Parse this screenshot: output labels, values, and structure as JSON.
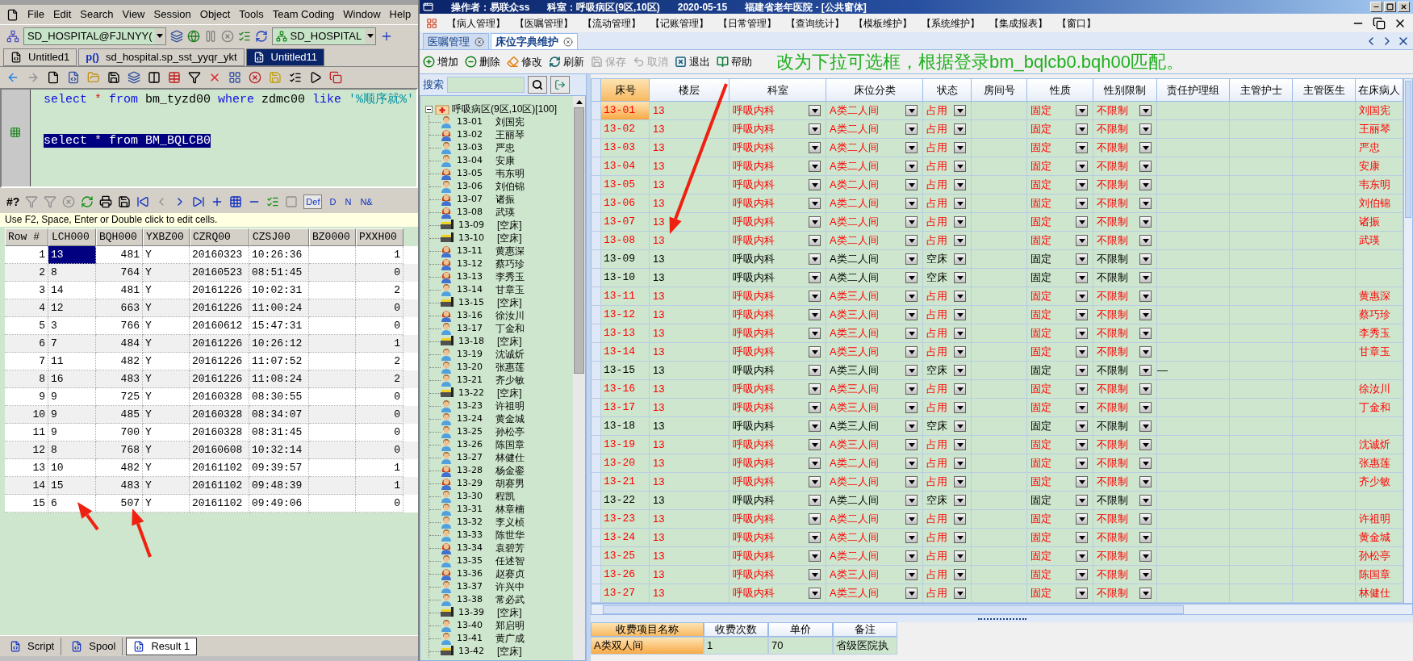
{
  "sql_window": {
    "menu": [
      "File",
      "Edit",
      "Search",
      "View",
      "Session",
      "Object",
      "Tools",
      "Team Coding",
      "Window",
      "Help"
    ],
    "connection": "SD_HOSPITAL@FJLNYY(",
    "schema": "SD_HOSPITAL",
    "tabs": [
      {
        "label": "Untitled1",
        "kind": "sql",
        "selected": false
      },
      {
        "label": "sd_hospital.sp_sst_yyqr_ykt",
        "kind": "proc",
        "prefix": "p()",
        "selected": false
      },
      {
        "label": "Untitled11",
        "kind": "sql",
        "selected": true
      }
    ],
    "editor_lines": [
      {
        "selected": false,
        "tokens": [
          {
            "kind": "keyword",
            "text": "select"
          },
          {
            "kind": "operator",
            "text": "*"
          },
          {
            "kind": "keyword",
            "text": "from"
          },
          {
            "kind": "ident",
            "text": "bm_tyzd00"
          },
          {
            "kind": "keyword",
            "text": "where"
          },
          {
            "kind": "ident",
            "text": "zdmc00"
          },
          {
            "kind": "keyword",
            "text": "like"
          },
          {
            "kind": "string",
            "text": "'%顺序就%'"
          }
        ]
      },
      {
        "selected": true,
        "tokens": [
          {
            "kind": "keyword",
            "text": "select"
          },
          {
            "kind": "operator",
            "text": "*"
          },
          {
            "kind": "keyword",
            "text": "from"
          },
          {
            "kind": "ident",
            "text": "BM_BQLCB0"
          }
        ]
      }
    ],
    "result_toolbar_label": "#?",
    "view_buttons": [
      {
        "label": "Def",
        "selected": true
      },
      {
        "label": "D",
        "selected": false
      },
      {
        "label": "N",
        "selected": false
      },
      {
        "label": "N&",
        "selected": false
      }
    ],
    "hint": "Use F2, Space, Enter or Double click to edit cells.",
    "result": {
      "columns": [
        "Row #",
        "LCH000",
        "BQH000",
        "YXBZ00",
        "CZRQ00",
        "CZSJ00",
        "BZ0000",
        "PXXH00"
      ],
      "rows": [
        {
          "row": "1",
          "lch000": "13",
          "bqh000": "481",
          "yxbz00": "Y",
          "czrq00": "20160323",
          "czsj00": "10:26:36",
          "pxxh00": "1",
          "selected": true
        },
        {
          "row": "2",
          "lch000": "8",
          "bqh000": "764",
          "yxbz00": "Y",
          "czrq00": "20160523",
          "czsj00": "08:51:45",
          "pxxh00": "0",
          "selected": false
        },
        {
          "row": "3",
          "lch000": "14",
          "bqh000": "481",
          "yxbz00": "Y",
          "czrq00": "20161226",
          "czsj00": "10:02:31",
          "pxxh00": "2",
          "selected": false
        },
        {
          "row": "4",
          "lch000": "12",
          "bqh000": "663",
          "yxbz00": "Y",
          "czrq00": "20161226",
          "czsj00": "11:00:24",
          "pxxh00": "0",
          "selected": false
        },
        {
          "row": "5",
          "lch000": "3",
          "bqh000": "766",
          "yxbz00": "Y",
          "czrq00": "20160612",
          "czsj00": "15:47:31",
          "pxxh00": "0",
          "selected": false
        },
        {
          "row": "6",
          "lch000": "7",
          "bqh000": "484",
          "yxbz00": "Y",
          "czrq00": "20161226",
          "czsj00": "10:26:12",
          "pxxh00": "1",
          "selected": false
        },
        {
          "row": "7",
          "lch000": "11",
          "bqh000": "482",
          "yxbz00": "Y",
          "czrq00": "20161226",
          "czsj00": "11:07:52",
          "pxxh00": "2",
          "selected": false
        },
        {
          "row": "8",
          "lch000": "16",
          "bqh000": "483",
          "yxbz00": "Y",
          "czrq00": "20161226",
          "czsj00": "11:08:24",
          "pxxh00": "2",
          "selected": false
        },
        {
          "row": "9",
          "lch000": "9",
          "bqh000": "725",
          "yxbz00": "Y",
          "czrq00": "20160328",
          "czsj00": "08:30:55",
          "pxxh00": "0",
          "selected": false
        },
        {
          "row": "10",
          "lch000": "9",
          "bqh000": "485",
          "yxbz00": "Y",
          "czrq00": "20160328",
          "czsj00": "08:34:07",
          "pxxh00": "0",
          "selected": false
        },
        {
          "row": "11",
          "lch000": "9",
          "bqh000": "700",
          "yxbz00": "Y",
          "czrq00": "20160328",
          "czsj00": "08:31:45",
          "pxxh00": "0",
          "selected": false
        },
        {
          "row": "12",
          "lch000": "8",
          "bqh000": "768",
          "yxbz00": "Y",
          "czrq00": "20160608",
          "czsj00": "10:32:14",
          "pxxh00": "0",
          "selected": false
        },
        {
          "row": "13",
          "lch000": "10",
          "bqh000": "482",
          "yxbz00": "Y",
          "czrq00": "20161102",
          "czsj00": "09:39:57",
          "pxxh00": "1",
          "selected": false
        },
        {
          "row": "14",
          "lch000": "15",
          "bqh000": "483",
          "yxbz00": "Y",
          "czrq00": "20161102",
          "czsj00": "09:48:39",
          "pxxh00": "1",
          "selected": false
        },
        {
          "row": "15",
          "lch000": "6",
          "bqh000": "507",
          "yxbz00": "Y",
          "czrq00": "20161102",
          "czsj00": "09:49:06",
          "pxxh00": "0",
          "selected": false
        }
      ]
    },
    "bottom_tabs": [
      {
        "label": "Script",
        "selected": false
      },
      {
        "label": "Spool",
        "selected": false
      },
      {
        "label": "Result 1",
        "selected": true
      }
    ]
  },
  "his_window": {
    "title_parts": [
      "操作者：易联众ss",
      "科室：呼吸病区(9区,10区)",
      "2020-05-15",
      "福建省老年医院 - [公共窗体]"
    ],
    "menu": [
      "【病人管理】",
      "【医嘱管理】",
      "【流动管理】",
      "【记账管理】",
      "【日常管理】",
      "【查询统计】",
      "【模板维护】",
      "【系统维护】",
      "【集成报表】",
      "【窗口】"
    ],
    "tabs": [
      {
        "label": "医嘱管理",
        "selected": false
      },
      {
        "label": "床位字典维护",
        "selected": true
      }
    ],
    "toolbar": [
      {
        "label": "增加",
        "kind": "add",
        "disabled": false
      },
      {
        "label": "删除",
        "kind": "delete",
        "disabled": false
      },
      {
        "label": "修改",
        "kind": "edit",
        "disabled": false
      },
      {
        "label": "刷新",
        "kind": "refresh",
        "disabled": false
      },
      {
        "label": "保存",
        "kind": "save",
        "disabled": true
      },
      {
        "label": "取消",
        "kind": "cancel",
        "disabled": true
      },
      {
        "label": "退出",
        "kind": "exit",
        "disabled": false
      },
      {
        "label": "帮助",
        "kind": "help",
        "disabled": false
      }
    ],
    "annotation": "改为下拉可选框，根据登录bm_bqlcb0.bqh00匹配。",
    "search_label": "搜索",
    "tree": {
      "label": "呼吸病区(9区,10区)[100]",
      "expanded": true,
      "children": [
        {
          "bed": "13-01",
          "name": "刘国宪",
          "kind": "male"
        },
        {
          "bed": "13-02",
          "name": "王丽琴",
          "kind": "female"
        },
        {
          "bed": "13-03",
          "name": "严忠",
          "kind": "male"
        },
        {
          "bed": "13-04",
          "name": "安康",
          "kind": "male"
        },
        {
          "bed": "13-05",
          "name": "韦东明",
          "kind": "female"
        },
        {
          "bed": "13-06",
          "name": "刘伯锦",
          "kind": "male"
        },
        {
          "bed": "13-07",
          "name": "诸振",
          "kind": "female"
        },
        {
          "bed": "13-08",
          "name": "武瑛",
          "kind": "female"
        },
        {
          "bed": "13-09",
          "name": "[空床]",
          "kind": "empty"
        },
        {
          "bed": "13-10",
          "name": "[空床]",
          "kind": "empty"
        },
        {
          "bed": "13-11",
          "name": "黄惠深",
          "kind": "female"
        },
        {
          "bed": "13-12",
          "name": "蔡巧珍",
          "kind": "female"
        },
        {
          "bed": "13-13",
          "name": "李秀玉",
          "kind": "female"
        },
        {
          "bed": "13-14",
          "name": "甘章玉",
          "kind": "male"
        },
        {
          "bed": "13-15",
          "name": "[空床]",
          "kind": "empty"
        },
        {
          "bed": "13-16",
          "name": "徐汝川",
          "kind": "female"
        },
        {
          "bed": "13-17",
          "name": "丁金和",
          "kind": "male"
        },
        {
          "bed": "13-18",
          "name": "[空床]",
          "kind": "empty"
        },
        {
          "bed": "13-19",
          "name": "沈诚炘",
          "kind": "male"
        },
        {
          "bed": "13-20",
          "name": "张惠莲",
          "kind": "male"
        },
        {
          "bed": "13-21",
          "name": "齐少敏",
          "kind": "male"
        },
        {
          "bed": "13-22",
          "name": "[空床]",
          "kind": "empty"
        },
        {
          "bed": "13-23",
          "name": "许祖明",
          "kind": "male"
        },
        {
          "bed": "13-24",
          "name": "黄金城",
          "kind": "male"
        },
        {
          "bed": "13-25",
          "name": "孙松亭",
          "kind": "male"
        },
        {
          "bed": "13-26",
          "name": "陈国章",
          "kind": "male"
        },
        {
          "bed": "13-27",
          "name": "林健仕",
          "kind": "male"
        },
        {
          "bed": "13-28",
          "name": "杨金銮",
          "kind": "female"
        },
        {
          "bed": "13-29",
          "name": "胡赛男",
          "kind": "female"
        },
        {
          "bed": "13-30",
          "name": "程凯",
          "kind": "male"
        },
        {
          "bed": "13-31",
          "name": "林章楠",
          "kind": "male"
        },
        {
          "bed": "13-32",
          "name": "李义桢",
          "kind": "male"
        },
        {
          "bed": "13-33",
          "name": "陈世华",
          "kind": "male"
        },
        {
          "bed": "13-34",
          "name": "袁碧芳",
          "kind": "female"
        },
        {
          "bed": "13-35",
          "name": "任述智",
          "kind": "male"
        },
        {
          "bed": "13-36",
          "name": "赵赛贞",
          "kind": "female"
        },
        {
          "bed": "13-37",
          "name": "许兴中",
          "kind": "male"
        },
        {
          "bed": "13-38",
          "name": "常必武",
          "kind": "male"
        },
        {
          "bed": "13-39",
          "name": "[空床]",
          "kind": "empty"
        },
        {
          "bed": "13-40",
          "name": "郑启明",
          "kind": "male"
        },
        {
          "bed": "13-41",
          "name": "黄广成",
          "kind": "male"
        },
        {
          "bed": "13-42",
          "name": "[空床]",
          "kind": "empty"
        }
      ]
    },
    "grid": {
      "columns": [
        "床号",
        "楼层",
        "科室",
        "床位分类",
        "状态",
        "房间号",
        "性质",
        "性别限制",
        "责任护理组",
        "主管护士",
        "主管医生",
        "在床病人"
      ],
      "rows": [
        {
          "bed": "13-01",
          "floor": "13",
          "dept": "呼吸内科",
          "category": "A类二人间",
          "status": "占用",
          "nature": "固定",
          "gender_limit": "不限制",
          "patient": "刘国宪",
          "occupied": true,
          "selected": true
        },
        {
          "bed": "13-02",
          "floor": "13",
          "dept": "呼吸内科",
          "category": "A类二人间",
          "status": "占用",
          "nature": "固定",
          "gender_limit": "不限制",
          "patient": "王丽琴",
          "occupied": true,
          "selected": false
        },
        {
          "bed": "13-03",
          "floor": "13",
          "dept": "呼吸内科",
          "category": "A类二人间",
          "status": "占用",
          "nature": "固定",
          "gender_limit": "不限制",
          "patient": "严忠",
          "occupied": true,
          "selected": false
        },
        {
          "bed": "13-04",
          "floor": "13",
          "dept": "呼吸内科",
          "category": "A类二人间",
          "status": "占用",
          "nature": "固定",
          "gender_limit": "不限制",
          "patient": "安康",
          "occupied": true,
          "selected": false
        },
        {
          "bed": "13-05",
          "floor": "13",
          "dept": "呼吸内科",
          "category": "A类二人间",
          "status": "占用",
          "nature": "固定",
          "gender_limit": "不限制",
          "patient": "韦东明",
          "occupied": true,
          "selected": false
        },
        {
          "bed": "13-06",
          "floor": "13",
          "dept": "呼吸内科",
          "category": "A类二人间",
          "status": "占用",
          "nature": "固定",
          "gender_limit": "不限制",
          "patient": "刘伯锦",
          "occupied": true,
          "selected": false
        },
        {
          "bed": "13-07",
          "floor": "13",
          "dept": "呼吸内科",
          "category": "A类二人间",
          "status": "占用",
          "nature": "固定",
          "gender_limit": "不限制",
          "patient": "诸振",
          "occupied": true,
          "selected": false
        },
        {
          "bed": "13-08",
          "floor": "13",
          "dept": "呼吸内科",
          "category": "A类二人间",
          "status": "占用",
          "nature": "固定",
          "gender_limit": "不限制",
          "patient": "武瑛",
          "occupied": true,
          "selected": false
        },
        {
          "bed": "13-09",
          "floor": "13",
          "dept": "呼吸内科",
          "category": "A类二人间",
          "status": "空床",
          "nature": "固定",
          "gender_limit": "不限制",
          "occupied": false,
          "selected": false
        },
        {
          "bed": "13-10",
          "floor": "13",
          "dept": "呼吸内科",
          "category": "A类二人间",
          "status": "空床",
          "nature": "固定",
          "gender_limit": "不限制",
          "occupied": false,
          "selected": false
        },
        {
          "bed": "13-11",
          "floor": "13",
          "dept": "呼吸内科",
          "category": "A类三人间",
          "status": "占用",
          "nature": "固定",
          "gender_limit": "不限制",
          "patient": "黄惠深",
          "occupied": true,
          "selected": false
        },
        {
          "bed": "13-12",
          "floor": "13",
          "dept": "呼吸内科",
          "category": "A类三人间",
          "status": "占用",
          "nature": "固定",
          "gender_limit": "不限制",
          "patient": "蔡巧珍",
          "occupied": true,
          "selected": false
        },
        {
          "bed": "13-13",
          "floor": "13",
          "dept": "呼吸内科",
          "category": "A类三人间",
          "status": "占用",
          "nature": "固定",
          "gender_limit": "不限制",
          "patient": "李秀玉",
          "occupied": true,
          "selected": false
        },
        {
          "bed": "13-14",
          "floor": "13",
          "dept": "呼吸内科",
          "category": "A类三人间",
          "status": "占用",
          "nature": "固定",
          "gender_limit": "不限制",
          "patient": "甘章玉",
          "occupied": true,
          "selected": false
        },
        {
          "bed": "13-15",
          "floor": "13",
          "dept": "呼吸内科",
          "category": "A类三人间",
          "status": "空床",
          "nature": "固定",
          "gender_limit": "不限制",
          "nurse_group": "—",
          "occupied": false,
          "selected": false
        },
        {
          "bed": "13-16",
          "floor": "13",
          "dept": "呼吸内科",
          "category": "A类三人间",
          "status": "占用",
          "nature": "固定",
          "gender_limit": "不限制",
          "patient": "徐汝川",
          "occupied": true,
          "selected": false
        },
        {
          "bed": "13-17",
          "floor": "13",
          "dept": "呼吸内科",
          "category": "A类三人间",
          "status": "占用",
          "nature": "固定",
          "gender_limit": "不限制",
          "patient": "丁金和",
          "occupied": true,
          "selected": false
        },
        {
          "bed": "13-18",
          "floor": "13",
          "dept": "呼吸内科",
          "category": "A类三人间",
          "status": "空床",
          "nature": "固定",
          "gender_limit": "不限制",
          "occupied": false,
          "selected": false
        },
        {
          "bed": "13-19",
          "floor": "13",
          "dept": "呼吸内科",
          "category": "A类三人间",
          "status": "占用",
          "nature": "固定",
          "gender_limit": "不限制",
          "patient": "沈诚炘",
          "occupied": true,
          "selected": false
        },
        {
          "bed": "13-20",
          "floor": "13",
          "dept": "呼吸内科",
          "category": "A类二人间",
          "status": "占用",
          "nature": "固定",
          "gender_limit": "不限制",
          "patient": "张惠莲",
          "occupied": true,
          "selected": false
        },
        {
          "bed": "13-21",
          "floor": "13",
          "dept": "呼吸内科",
          "category": "A类二人间",
          "status": "占用",
          "nature": "固定",
          "gender_limit": "不限制",
          "patient": "齐少敏",
          "occupied": true,
          "selected": false
        },
        {
          "bed": "13-22",
          "floor": "13",
          "dept": "呼吸内科",
          "category": "A类二人间",
          "status": "空床",
          "nature": "固定",
          "gender_limit": "不限制",
          "occupied": false,
          "selected": false
        },
        {
          "bed": "13-23",
          "floor": "13",
          "dept": "呼吸内科",
          "category": "A类二人间",
          "status": "占用",
          "nature": "固定",
          "gender_limit": "不限制",
          "patient": "许祖明",
          "occupied": true,
          "selected": false
        },
        {
          "bed": "13-24",
          "floor": "13",
          "dept": "呼吸内科",
          "category": "A类二人间",
          "status": "占用",
          "nature": "固定",
          "gender_limit": "不限制",
          "patient": "黄金城",
          "occupied": true,
          "selected": false
        },
        {
          "bed": "13-25",
          "floor": "13",
          "dept": "呼吸内科",
          "category": "A类二人间",
          "status": "占用",
          "nature": "固定",
          "gender_limit": "不限制",
          "patient": "孙松亭",
          "occupied": true,
          "selected": false
        },
        {
          "bed": "13-26",
          "floor": "13",
          "dept": "呼吸内科",
          "category": "A类三人间",
          "status": "占用",
          "nature": "固定",
          "gender_limit": "不限制",
          "patient": "陈国章",
          "occupied": true,
          "selected": false
        },
        {
          "bed": "13-27",
          "floor": "13",
          "dept": "呼吸内科",
          "category": "A类三人间",
          "status": "占用",
          "nature": "固定",
          "gender_limit": "不限制",
          "patient": "林健仕",
          "occupied": true,
          "selected": false
        }
      ]
    },
    "fee_grid": {
      "columns": [
        "收费项目名称",
        "收费次数",
        "单价",
        "备注"
      ],
      "rows": [
        {
          "cells": [
            "A类双人间",
            "1",
            "70",
            "省级医院执"
          ],
          "selected": true
        }
      ]
    }
  }
}
